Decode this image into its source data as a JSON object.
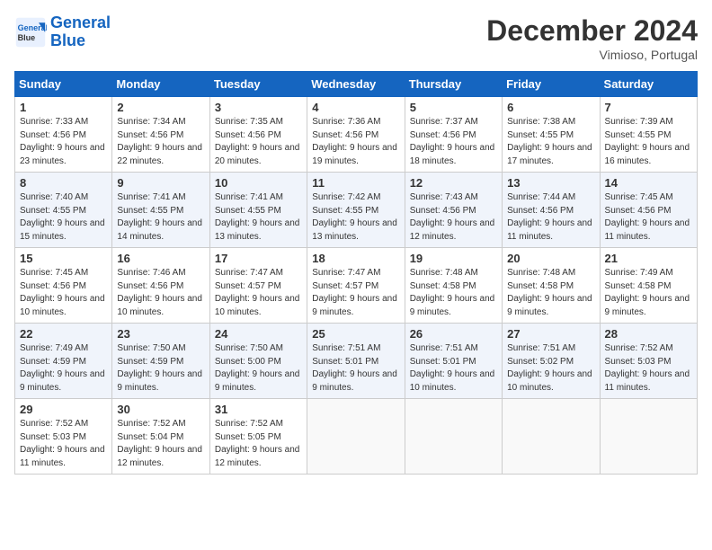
{
  "header": {
    "logo_line1": "General",
    "logo_line2": "Blue",
    "month": "December 2024",
    "location": "Vimioso, Portugal"
  },
  "weekdays": [
    "Sunday",
    "Monday",
    "Tuesday",
    "Wednesday",
    "Thursday",
    "Friday",
    "Saturday"
  ],
  "weeks": [
    [
      {
        "day": "1",
        "sunrise": "7:33 AM",
        "sunset": "4:56 PM",
        "daylight": "9 hours and 23 minutes."
      },
      {
        "day": "2",
        "sunrise": "7:34 AM",
        "sunset": "4:56 PM",
        "daylight": "9 hours and 22 minutes."
      },
      {
        "day": "3",
        "sunrise": "7:35 AM",
        "sunset": "4:56 PM",
        "daylight": "9 hours and 20 minutes."
      },
      {
        "day": "4",
        "sunrise": "7:36 AM",
        "sunset": "4:56 PM",
        "daylight": "9 hours and 19 minutes."
      },
      {
        "day": "5",
        "sunrise": "7:37 AM",
        "sunset": "4:56 PM",
        "daylight": "9 hours and 18 minutes."
      },
      {
        "day": "6",
        "sunrise": "7:38 AM",
        "sunset": "4:55 PM",
        "daylight": "9 hours and 17 minutes."
      },
      {
        "day": "7",
        "sunrise": "7:39 AM",
        "sunset": "4:55 PM",
        "daylight": "9 hours and 16 minutes."
      }
    ],
    [
      {
        "day": "8",
        "sunrise": "7:40 AM",
        "sunset": "4:55 PM",
        "daylight": "9 hours and 15 minutes."
      },
      {
        "day": "9",
        "sunrise": "7:41 AM",
        "sunset": "4:55 PM",
        "daylight": "9 hours and 14 minutes."
      },
      {
        "day": "10",
        "sunrise": "7:41 AM",
        "sunset": "4:55 PM",
        "daylight": "9 hours and 13 minutes."
      },
      {
        "day": "11",
        "sunrise": "7:42 AM",
        "sunset": "4:55 PM",
        "daylight": "9 hours and 13 minutes."
      },
      {
        "day": "12",
        "sunrise": "7:43 AM",
        "sunset": "4:56 PM",
        "daylight": "9 hours and 12 minutes."
      },
      {
        "day": "13",
        "sunrise": "7:44 AM",
        "sunset": "4:56 PM",
        "daylight": "9 hours and 11 minutes."
      },
      {
        "day": "14",
        "sunrise": "7:45 AM",
        "sunset": "4:56 PM",
        "daylight": "9 hours and 11 minutes."
      }
    ],
    [
      {
        "day": "15",
        "sunrise": "7:45 AM",
        "sunset": "4:56 PM",
        "daylight": "9 hours and 10 minutes."
      },
      {
        "day": "16",
        "sunrise": "7:46 AM",
        "sunset": "4:56 PM",
        "daylight": "9 hours and 10 minutes."
      },
      {
        "day": "17",
        "sunrise": "7:47 AM",
        "sunset": "4:57 PM",
        "daylight": "9 hours and 10 minutes."
      },
      {
        "day": "18",
        "sunrise": "7:47 AM",
        "sunset": "4:57 PM",
        "daylight": "9 hours and 9 minutes."
      },
      {
        "day": "19",
        "sunrise": "7:48 AM",
        "sunset": "4:58 PM",
        "daylight": "9 hours and 9 minutes."
      },
      {
        "day": "20",
        "sunrise": "7:48 AM",
        "sunset": "4:58 PM",
        "daylight": "9 hours and 9 minutes."
      },
      {
        "day": "21",
        "sunrise": "7:49 AM",
        "sunset": "4:58 PM",
        "daylight": "9 hours and 9 minutes."
      }
    ],
    [
      {
        "day": "22",
        "sunrise": "7:49 AM",
        "sunset": "4:59 PM",
        "daylight": "9 hours and 9 minutes."
      },
      {
        "day": "23",
        "sunrise": "7:50 AM",
        "sunset": "4:59 PM",
        "daylight": "9 hours and 9 minutes."
      },
      {
        "day": "24",
        "sunrise": "7:50 AM",
        "sunset": "5:00 PM",
        "daylight": "9 hours and 9 minutes."
      },
      {
        "day": "25",
        "sunrise": "7:51 AM",
        "sunset": "5:01 PM",
        "daylight": "9 hours and 9 minutes."
      },
      {
        "day": "26",
        "sunrise": "7:51 AM",
        "sunset": "5:01 PM",
        "daylight": "9 hours and 10 minutes."
      },
      {
        "day": "27",
        "sunrise": "7:51 AM",
        "sunset": "5:02 PM",
        "daylight": "9 hours and 10 minutes."
      },
      {
        "day": "28",
        "sunrise": "7:52 AM",
        "sunset": "5:03 PM",
        "daylight": "9 hours and 11 minutes."
      }
    ],
    [
      {
        "day": "29",
        "sunrise": "7:52 AM",
        "sunset": "5:03 PM",
        "daylight": "9 hours and 11 minutes."
      },
      {
        "day": "30",
        "sunrise": "7:52 AM",
        "sunset": "5:04 PM",
        "daylight": "9 hours and 12 minutes."
      },
      {
        "day": "31",
        "sunrise": "7:52 AM",
        "sunset": "5:05 PM",
        "daylight": "9 hours and 12 minutes."
      },
      null,
      null,
      null,
      null
    ]
  ]
}
